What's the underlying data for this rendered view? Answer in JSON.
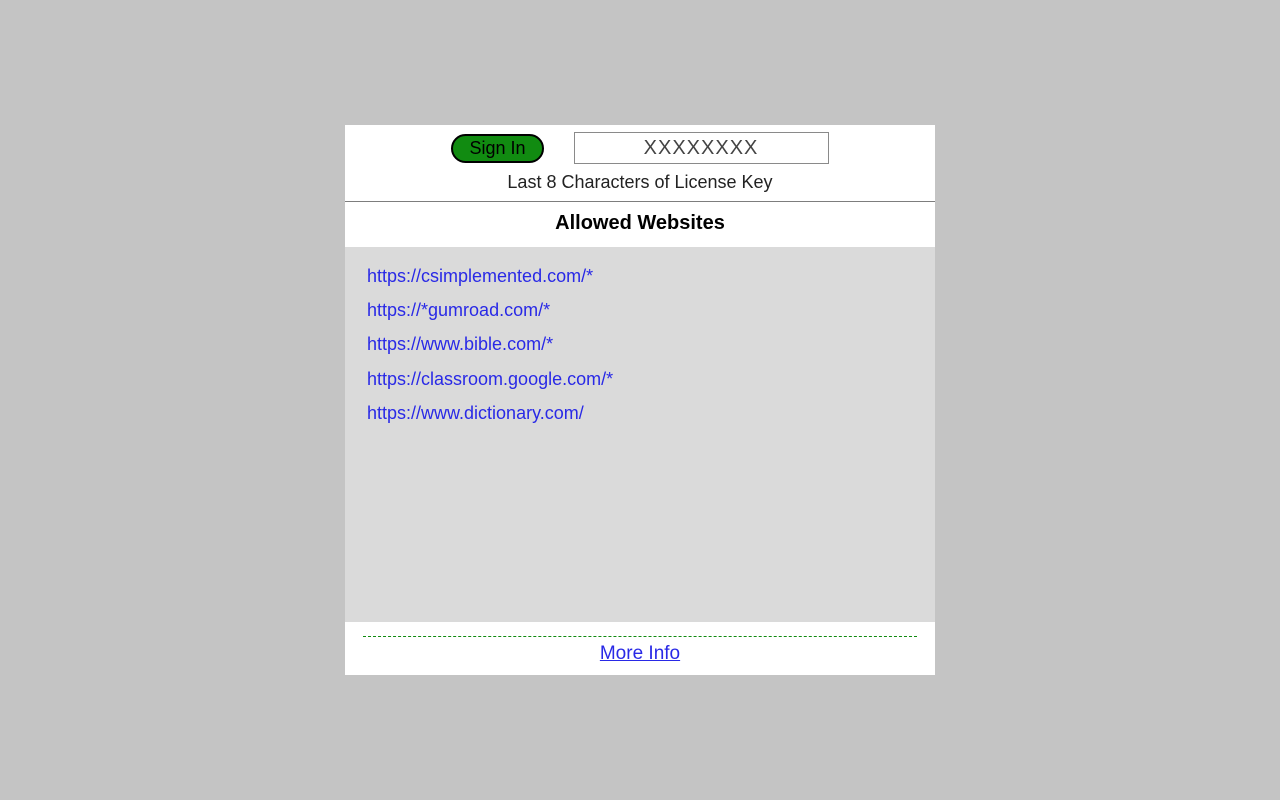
{
  "header": {
    "signin_label": "Sign In",
    "key_value": "XXXXXXXX",
    "sublabel": "Last 8 Characters of License Key"
  },
  "section": {
    "title": "Allowed Websites",
    "urls": [
      "https://csimplemented.com/*",
      "https://*gumroad.com/*",
      "https://www.bible.com/*",
      "https://classroom.google.com/*",
      "https://www.dictionary.com/"
    ]
  },
  "footer": {
    "more_info": "More Info"
  }
}
